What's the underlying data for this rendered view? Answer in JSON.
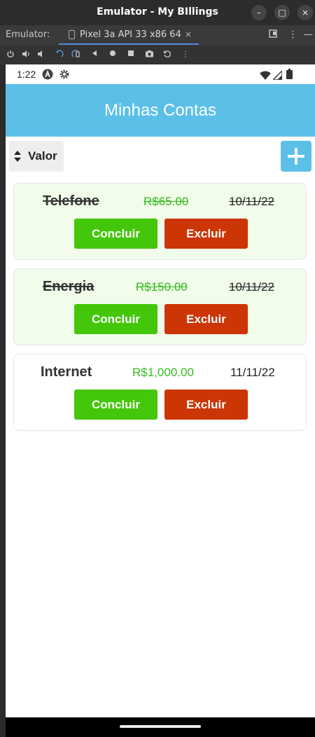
{
  "window": {
    "title": "Emulator - My BIllings",
    "minimize_glyph": "–",
    "maximize_glyph": "□",
    "close_glyph": "×"
  },
  "emulator": {
    "label": "Emulator:",
    "tab_label": "Pixel 3a API 33 x86 64",
    "tab_close_glyph": "×",
    "more_glyph": "⋮",
    "collapse_glyph": "—",
    "toolbar_icons": [
      "power-icon",
      "volume-up-icon",
      "volume-down-icon",
      "rotate-left-icon",
      "rotate-right-icon",
      "back-icon",
      "home-icon",
      "overview-icon",
      "camera-icon",
      "replay-icon",
      "more-icon"
    ]
  },
  "status": {
    "time": "1:22"
  },
  "app": {
    "title": "Minhas Contas",
    "sort_label": "Valor",
    "accent_color": "#5bbfe8"
  },
  "bills": [
    {
      "name": "Telefone",
      "value": "R$65.00",
      "date": "10/11/22",
      "completed": true,
      "complete_label": "Concluir",
      "delete_label": "Excluir"
    },
    {
      "name": "Energia",
      "value": "R$150.00",
      "date": "10/11/22",
      "completed": true,
      "complete_label": "Concluir",
      "delete_label": "Excluir"
    },
    {
      "name": "Internet",
      "value": "R$1,000.00",
      "date": "11/11/22",
      "completed": false,
      "complete_label": "Concluir",
      "delete_label": "Excluir"
    }
  ],
  "colors": {
    "complete_button": "#44c70a",
    "delete_button": "#cc3505",
    "value_text": "#33bb1a",
    "completed_card_bg": "#f1fdea"
  }
}
